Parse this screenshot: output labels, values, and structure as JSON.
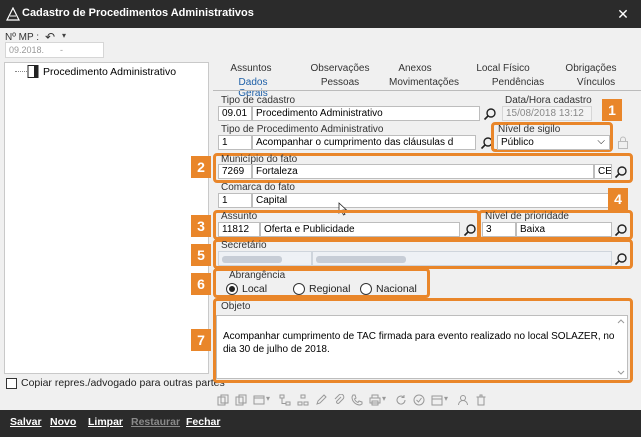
{
  "window": {
    "title": "Cadastro de Procedimentos Administrativos",
    "close_glyph": "✕"
  },
  "top": {
    "mp_label": "Nº MP :",
    "mp_value_a": "09.2018.",
    "mp_value_b": "-"
  },
  "tree": {
    "root_label": "Procedimento Administrativo"
  },
  "copy_checkbox": {
    "label": "Copiar repres./advogado para outras partes"
  },
  "tabs": {
    "row1": [
      "Assuntos",
      "Observações",
      "Anexos",
      "Local Físico",
      "Obrigações"
    ],
    "row2": [
      "Dados Gerais",
      "Pessoas",
      "Movimentações",
      "Pendências",
      "Vínculos"
    ],
    "active": "Dados Gerais"
  },
  "form": {
    "tipo_cadastro": {
      "label": "Tipo de cadastro",
      "code": "09.01",
      "value": "Procedimento Administrativo"
    },
    "data_hora": {
      "label": "Data/Hora cadastro",
      "value": "15/08/2018 13:12"
    },
    "tipo_procedimento": {
      "label": "Tipo de Procedimento Administrativo",
      "code": "1",
      "value": "Acompanhar o cumprimento das cláusulas d"
    },
    "nivel_sigilo": {
      "label": "Nível de sigilo",
      "value": "Público"
    },
    "municipio": {
      "label": "Município do fato",
      "code": "7269",
      "value": "Fortaleza",
      "uf": "CE"
    },
    "comarca": {
      "label": "Comarca do fato",
      "code": "1",
      "value": "Capital"
    },
    "assunto": {
      "label": "Assunto",
      "code": "11812",
      "value": "Oferta e Publicidade"
    },
    "prioridade": {
      "label": "Nível de prioridade",
      "code": "3",
      "value": "Baixa"
    },
    "secretario": {
      "label": "Secretário"
    },
    "abrangencia": {
      "label": "Abrangência",
      "options": [
        "Local",
        "Regional",
        "Nacional"
      ],
      "selected": "Local"
    },
    "objeto": {
      "label": "Objeto",
      "value": "Acompanhar cumprimento de TAC firmada para evento realizado no local SOLAZER, no dia 30 de julho de 2018."
    }
  },
  "badges": [
    "1",
    "2",
    "3",
    "4",
    "5",
    "6",
    "7"
  ],
  "bottom_buttons": {
    "salvar": "Salvar",
    "novo": "Novo",
    "limpar": "Limpar",
    "restaurar": "Restaurar",
    "fechar": "Fechar"
  },
  "colors": {
    "accent": "#e9862a",
    "titlebar": "#2b2b2b",
    "active_tab": "#1d5fa7"
  }
}
